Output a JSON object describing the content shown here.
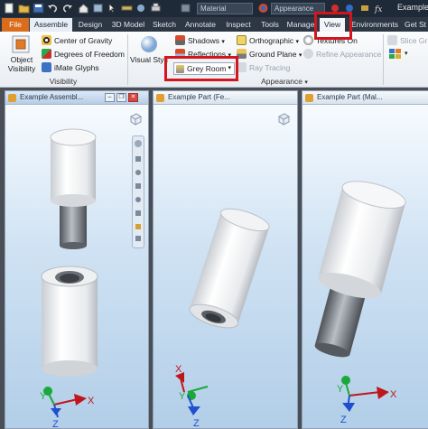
{
  "titlebar": {
    "material": "Material",
    "appearance": "Appearance",
    "title": "Example"
  },
  "tabs": {
    "file": "File",
    "assemble": "Assemble",
    "design": "Design",
    "model3d": "3D Model",
    "sketch": "Sketch",
    "annotate": "Annotate",
    "inspect": "Inspect",
    "tools": "Tools",
    "manage": "Manage",
    "view": "View",
    "environments": "Environments",
    "get_started": "Get St"
  },
  "ribbon": {
    "object_visibility": "Object Visibility",
    "center_of_gravity": "Center of Gravity",
    "degrees_of_freedom": "Degrees of Freedom",
    "imate_glyphs": "iMate Glyphs",
    "visibility_group": "Visibility",
    "visual_style": "Visual Style",
    "shadows": "Shadows",
    "reflections": "Reflections",
    "grey_room": "Grey Room",
    "orthographic": "Orthographic",
    "ground_plane": "Ground Plane",
    "ray_tracing": "Ray Tracing",
    "textures_on": "Textures On",
    "refine_appearance": "Refine Appearance",
    "appearance_group": "Appearance",
    "slice_graphics": "Slice Gr"
  },
  "views": {
    "assembly_title": "Example Assembl...",
    "part_fe_title": "Example Part (Fe...",
    "part_mal_title": "Example Part (Mal..."
  },
  "triad": {
    "x": "X",
    "y": "Y",
    "z": "Z"
  },
  "colors": {
    "file_tab": "#d96d1c",
    "highlight": "#d4151d",
    "triad_x": "#c0151b",
    "triad_y": "#1aa83a",
    "triad_z": "#1e4fcf"
  }
}
